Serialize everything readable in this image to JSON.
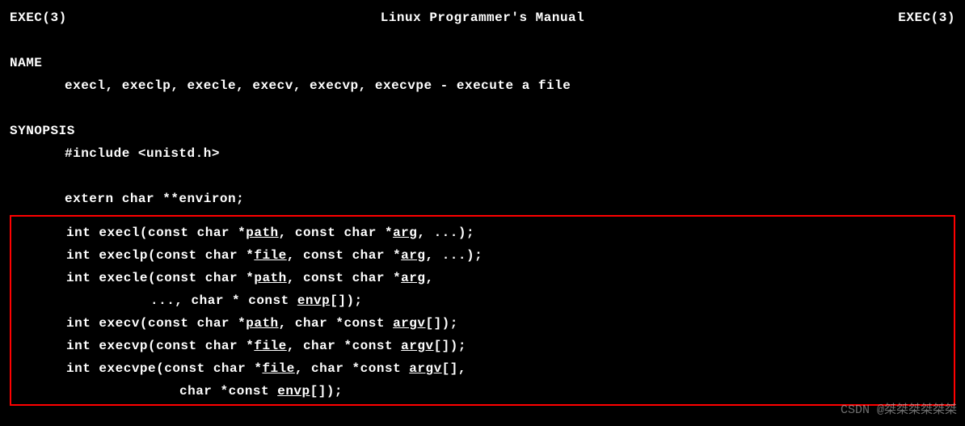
{
  "header": {
    "left": "EXEC(3)",
    "center": "Linux Programmer's Manual",
    "right": "EXEC(3)"
  },
  "sections": {
    "name_heading": "NAME",
    "name_body": "execl, execlp, execle, execv, execvp, execvpe - execute a file",
    "synopsis_heading": "SYNOPSIS",
    "include_line": "#include <unistd.h>",
    "extern_line": "extern char **environ;"
  },
  "signatures": {
    "execl": {
      "prefix": "int execl(const char *",
      "p1": "path",
      "mid": ", const char *",
      "p2": "arg",
      "suffix": ", ...);"
    },
    "execlp": {
      "prefix": "int execlp(const char *",
      "p1": "file",
      "mid": ", const char *",
      "p2": "arg",
      "suffix": ", ...);"
    },
    "execle_l1": {
      "prefix": "int execle(const char *",
      "p1": "path",
      "mid": ", const char *",
      "p2": "arg",
      "suffix": ","
    },
    "execle_l2": {
      "prefix": "..., char * const ",
      "p1": "envp",
      "suffix": "[]);"
    },
    "execv": {
      "prefix": "int execv(const char *",
      "p1": "path",
      "mid": ", char *const ",
      "p2": "argv",
      "suffix": "[]);"
    },
    "execvp": {
      "prefix": "int execvp(const char *",
      "p1": "file",
      "mid": ", char *const ",
      "p2": "argv",
      "suffix": "[]);"
    },
    "execvpe_l1": {
      "prefix": "int execvpe(const char *",
      "p1": "file",
      "mid": ", char *const ",
      "p2": "argv",
      "suffix": "[],"
    },
    "execvpe_l2": {
      "prefix": "char *const ",
      "p1": "envp",
      "suffix": "[]);"
    }
  },
  "watermark": "CSDN @桀桀桀桀桀桀"
}
